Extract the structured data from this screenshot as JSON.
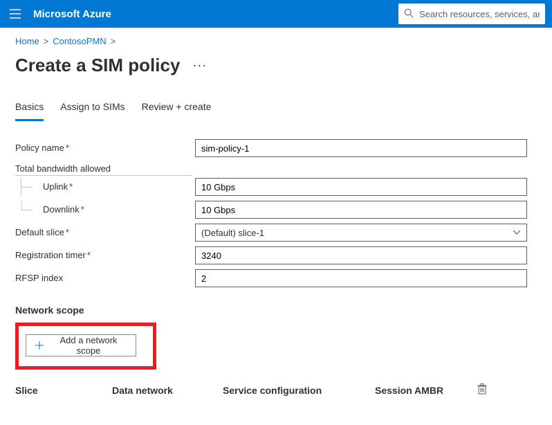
{
  "topbar": {
    "brand": "Microsoft Azure",
    "search_placeholder": "Search resources, services, and docs"
  },
  "breadcrumb": {
    "items": [
      "Home",
      "ContosoPMN"
    ],
    "sep": ">"
  },
  "page": {
    "title": "Create a SIM policy",
    "ellipsis": "···"
  },
  "tabs": {
    "items": [
      "Basics",
      "Assign to SIMs",
      "Review + create"
    ],
    "active_index": 0
  },
  "form": {
    "policy_name_label": "Policy name",
    "policy_name_value": "sim-policy-1",
    "bandwidth_group_label": "Total bandwidth allowed",
    "uplink_label": "Uplink",
    "uplink_value": "10 Gbps",
    "downlink_label": "Downlink",
    "downlink_value": "10 Gbps",
    "default_slice_label": "Default slice",
    "default_slice_value": "(Default) slice-1",
    "registration_timer_label": "Registration timer",
    "registration_timer_value": "3240",
    "rfsp_label": "RFSP index",
    "rfsp_value": "2",
    "required_marker": "*"
  },
  "network_scope": {
    "title": "Network scope",
    "add_button_label": "Add a network scope",
    "columns": [
      "Slice",
      "Data network",
      "Service configuration",
      "Session AMBR"
    ]
  }
}
